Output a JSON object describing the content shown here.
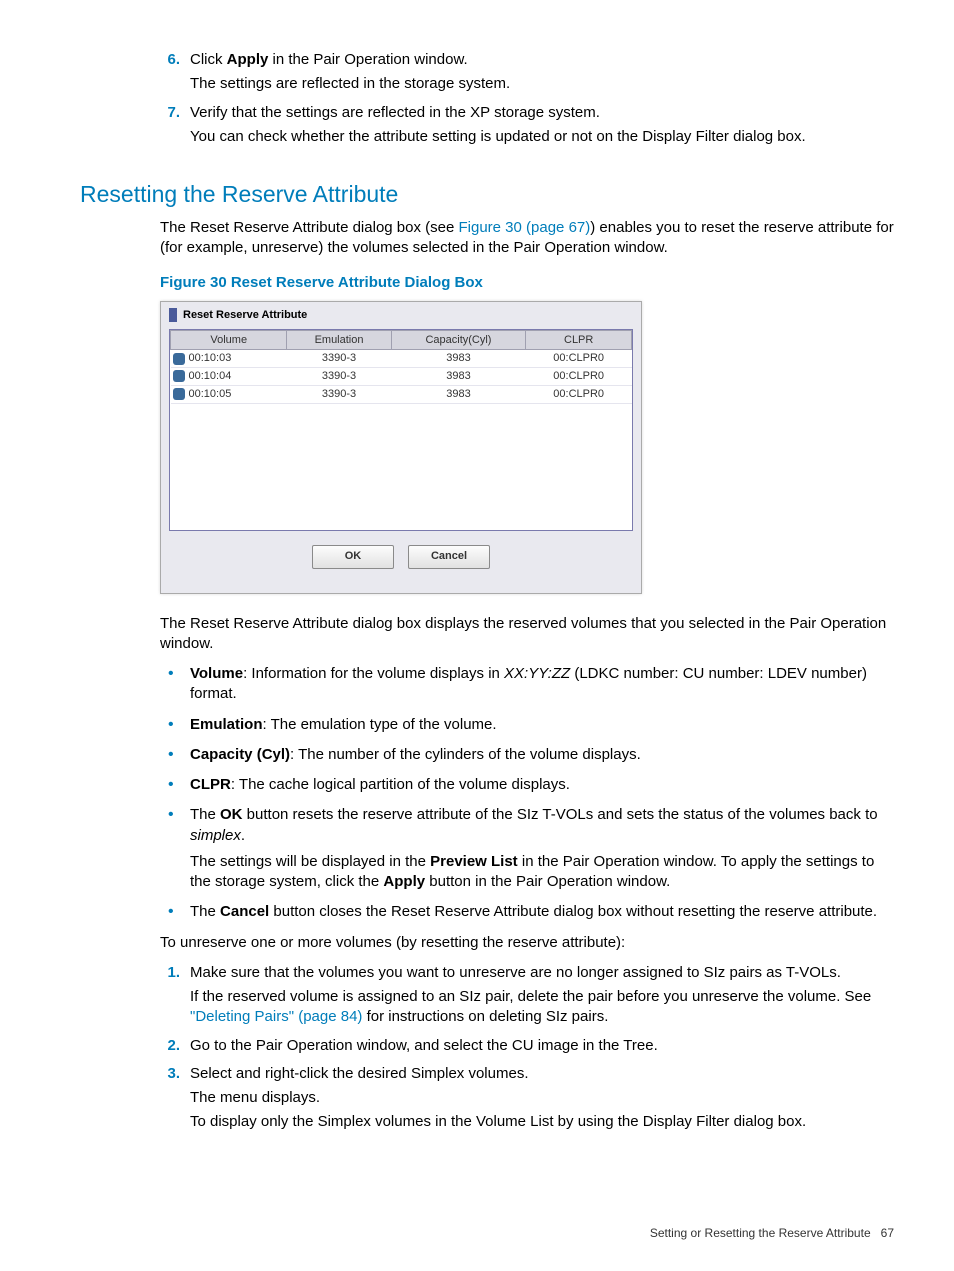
{
  "steps_top": [
    {
      "num": "6.",
      "line1_prefix": "Click ",
      "line1_bold": "Apply",
      "line1_suffix": " in the Pair Operation window.",
      "line2": "The settings are reflected in the storage system."
    },
    {
      "num": "7.",
      "line1": "Verify that the settings are reflected in the XP storage system.",
      "line2": "You can check whether the attribute setting is updated or not on the Display Filter dialog box."
    }
  ],
  "section_title": "Resetting the Reserve Attribute",
  "intro_prefix": "The Reset Reserve Attribute dialog box (see ",
  "intro_link": "Figure 30 (page 67)",
  "intro_suffix": ") enables you to reset the reserve attribute for (for example, unreserve) the volumes selected in the Pair Operation window.",
  "figure_caption": "Figure 30 Reset Reserve Attribute Dialog Box",
  "dialog": {
    "title": "Reset Reserve Attribute",
    "columns": [
      "Volume",
      "Emulation",
      "Capacity(Cyl)",
      "CLPR"
    ],
    "rows": [
      {
        "volume": "00:10:03",
        "emulation": "3390-3",
        "capacity": "3983",
        "clpr": "00:CLPR0"
      },
      {
        "volume": "00:10:04",
        "emulation": "3390-3",
        "capacity": "3983",
        "clpr": "00:CLPR0"
      },
      {
        "volume": "00:10:05",
        "emulation": "3390-3",
        "capacity": "3983",
        "clpr": "00:CLPR0"
      }
    ],
    "ok_label": "OK",
    "cancel_label": "Cancel"
  },
  "after_dialog": "The Reset Reserve Attribute dialog box displays the reserved volumes that you selected in the Pair Operation window.",
  "bullets": [
    {
      "bold": "Volume",
      "text_after_bold": ": Information for the volume displays in ",
      "italic": "XX:YY:ZZ",
      "text_after_italic": " (LDKC number: CU number: LDEV number) format."
    },
    {
      "bold": "Emulation",
      "text_after_bold": ": The emulation type of the volume."
    },
    {
      "bold": "Capacity (Cyl)",
      "text_after_bold": ": The number of the cylinders of the volume displays."
    },
    {
      "bold": "CLPR",
      "text_after_bold": ": The cache logical partition of the volume displays."
    },
    {
      "text_before_bold": "The ",
      "bold": "OK",
      "text_after_bold": " button resets the reserve attribute of the SIz T-VOLs and sets the status of the volumes back to ",
      "italic": "simplex",
      "text_after_italic": ".",
      "extra_prefix": "The settings will be displayed in the ",
      "extra_bold1": "Preview List",
      "extra_mid": " in the Pair Operation window. To apply the settings to the storage system, click the ",
      "extra_bold2": "Apply",
      "extra_suffix": " button in the Pair Operation window."
    },
    {
      "text_before_bold": "The ",
      "bold": "Cancel",
      "text_after_bold": " button closes the Reset Reserve Attribute dialog box without resetting the reserve attribute."
    }
  ],
  "unreserve_intro": "To unreserve one or more volumes (by resetting the reserve attribute):",
  "steps_bottom": [
    {
      "num": "1.",
      "line1": "Make sure that the volumes you want to unreserve are no longer assigned to SIz pairs as T-VOLs.",
      "line2_prefix": "If the reserved volume is assigned to an SIz pair, delete the pair before you unreserve the volume. See ",
      "line2_link": "\"Deleting Pairs\" (page 84)",
      "line2_suffix": " for instructions on deleting SIz pairs."
    },
    {
      "num": "2.",
      "line1": "Go to the Pair Operation window, and select the CU image in the Tree."
    },
    {
      "num": "3.",
      "line1": "Select and right-click the desired Simplex volumes.",
      "line2": "The menu displays.",
      "line3": "To display only the Simplex volumes in the Volume List by using the Display Filter dialog box."
    }
  ],
  "footer_text": "Setting or Resetting the Reserve Attribute",
  "footer_page": "67"
}
